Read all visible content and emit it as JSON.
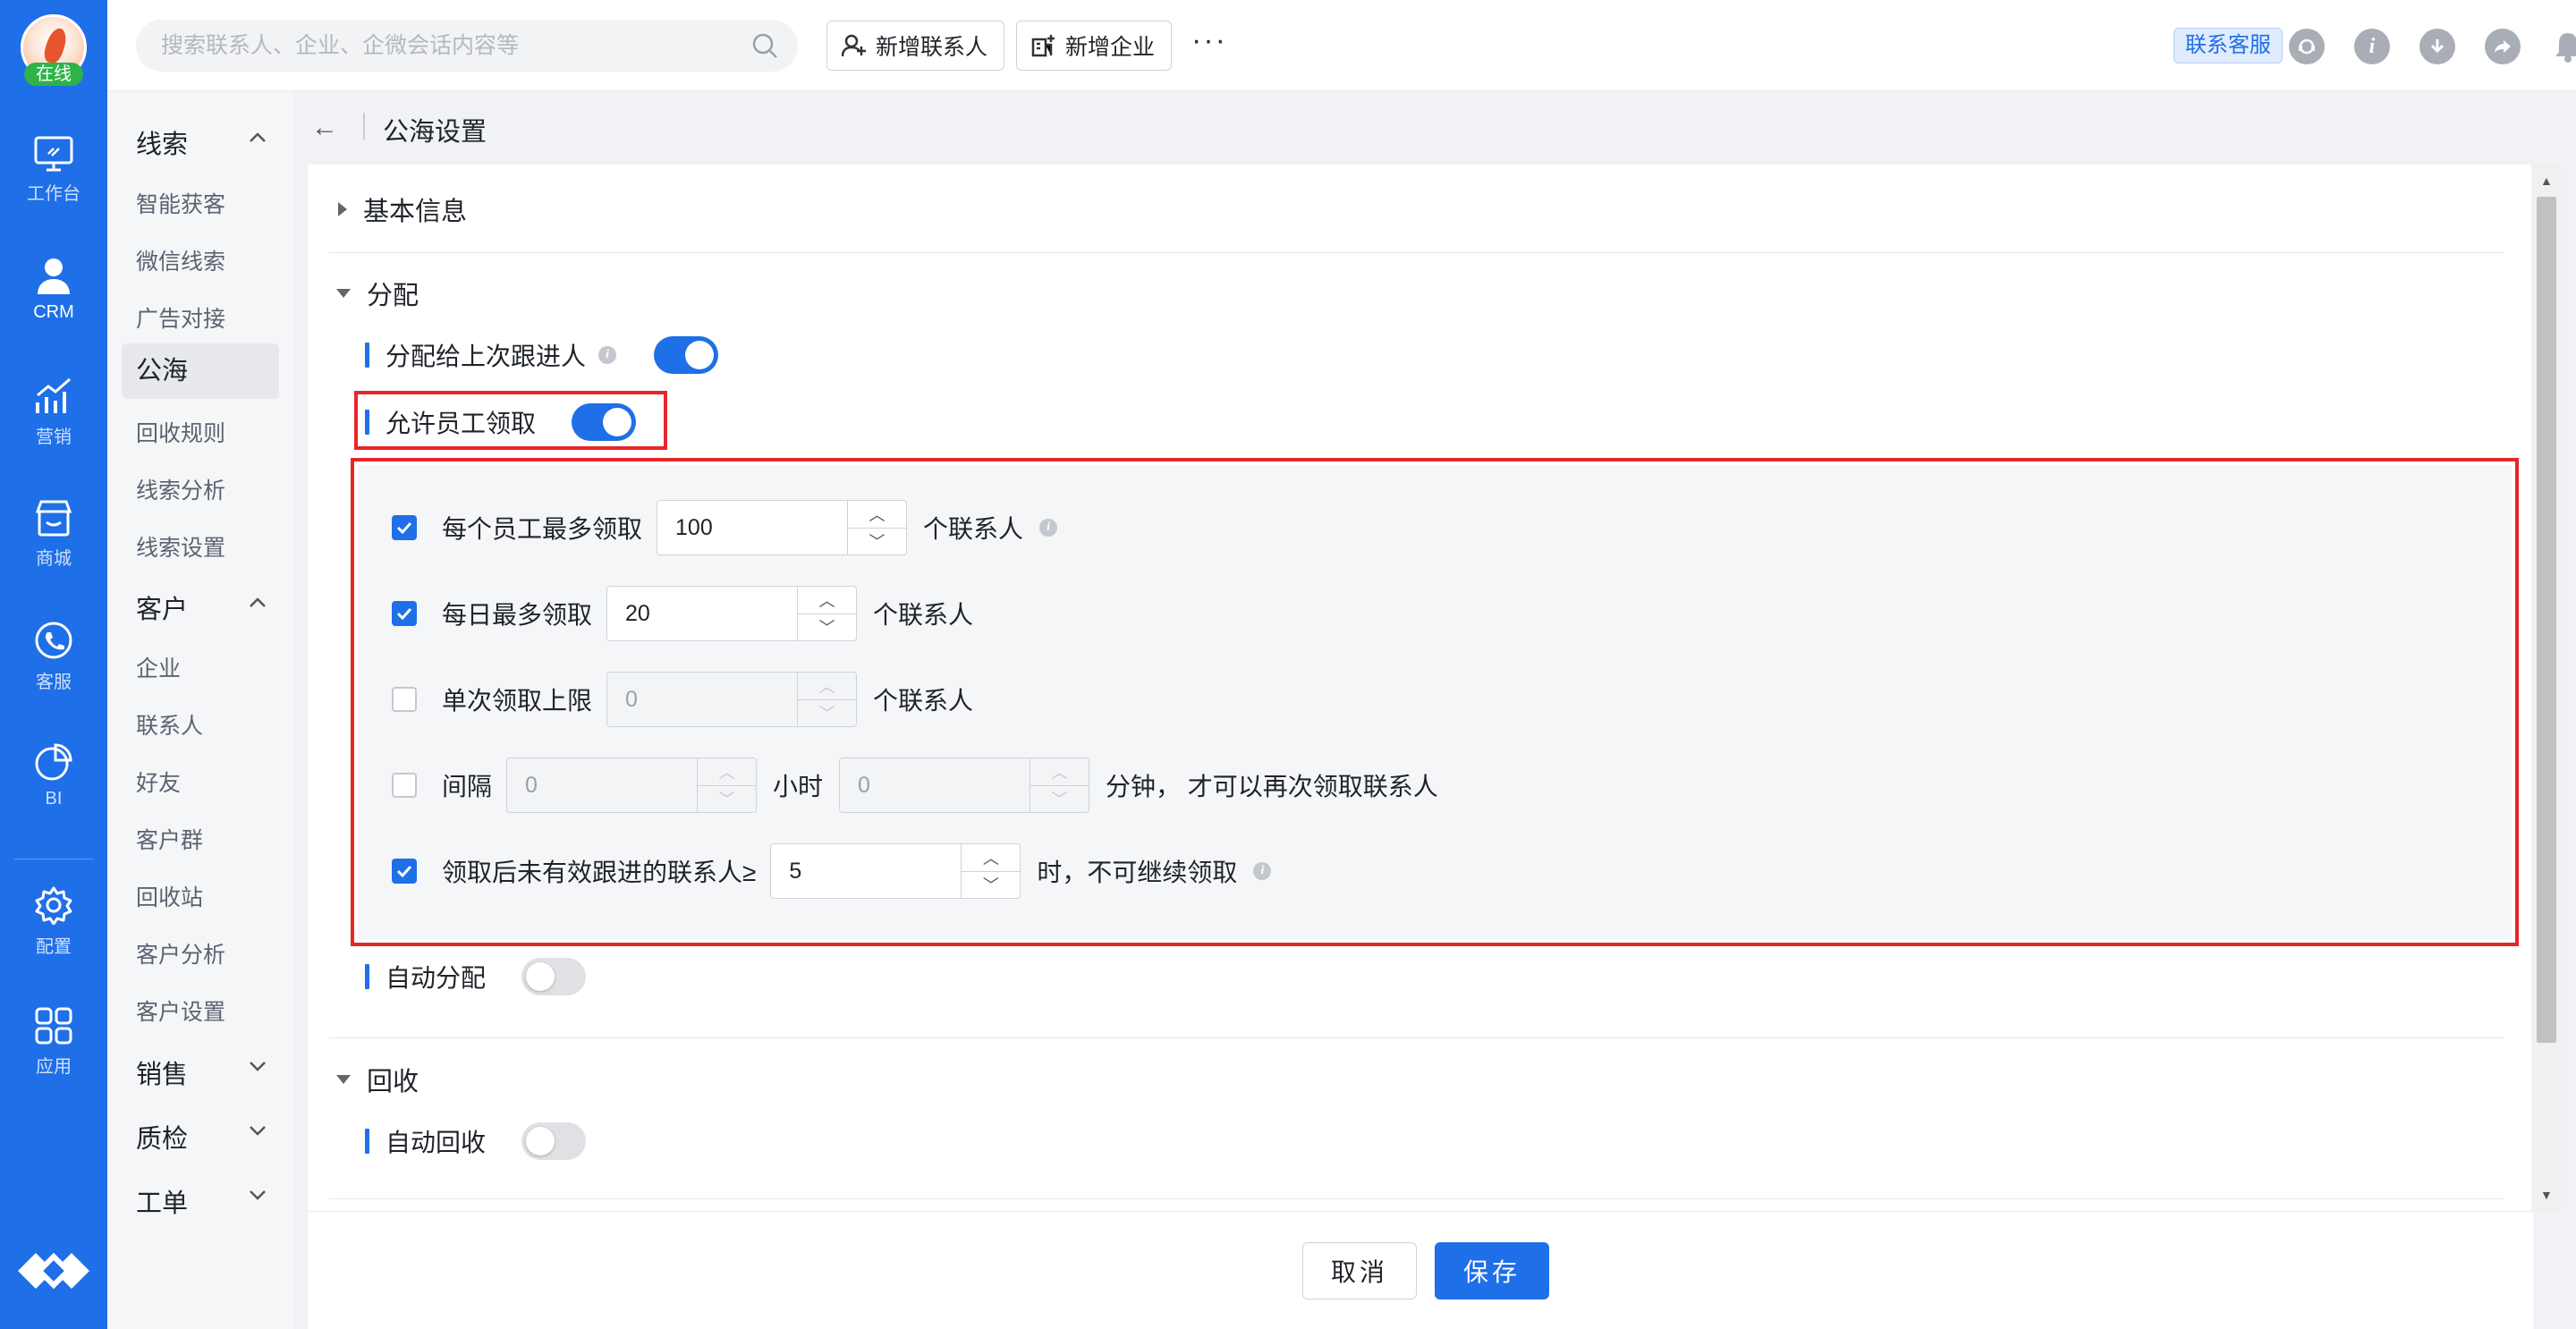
{
  "rail": {
    "status": "在线",
    "items": [
      {
        "label": "工作台",
        "icon": "workbench-icon"
      },
      {
        "label": "CRM",
        "icon": "person-icon"
      },
      {
        "label": "营销",
        "icon": "growth-chart-icon"
      },
      {
        "label": "商城",
        "icon": "store-icon"
      },
      {
        "label": "客服",
        "icon": "phone-icon"
      },
      {
        "label": "BI",
        "icon": "pie-chart-icon"
      },
      {
        "label": "配置",
        "icon": "gear-icon"
      },
      {
        "label": "应用",
        "icon": "apps-grid-icon"
      }
    ],
    "active": "CRM"
  },
  "topbar": {
    "search_placeholder": "搜索联系人、企业、企微会话内容等",
    "add_contact": "新增联系人",
    "add_company": "新增企业",
    "more": "···",
    "customer_service": "联系客服"
  },
  "menu": {
    "groups": [
      {
        "label": "线索",
        "expanded": true,
        "items": [
          "智能获客",
          "微信线索",
          "广告对接",
          "公海",
          "回收规则",
          "线索分析",
          "线索设置"
        ]
      },
      {
        "label": "客户",
        "expanded": true,
        "items": [
          "企业",
          "联系人",
          "好友",
          "客户群",
          "回收站",
          "客户分析",
          "客户设置"
        ]
      },
      {
        "label": "销售",
        "expanded": false
      },
      {
        "label": "质检",
        "expanded": false
      },
      {
        "label": "工单",
        "expanded": false
      }
    ],
    "active": "公海"
  },
  "page": {
    "back": "←",
    "title": "公海设置"
  },
  "sections": {
    "basic": "基本信息",
    "assign": "分配",
    "assign_last": "分配给上次跟进人",
    "allow_claim": "允许员工领取",
    "auto_assign": "自动分配",
    "recycle": "回收",
    "auto_recycle": "自动回收"
  },
  "rules": [
    {
      "checked": true,
      "label": "每个员工最多领取",
      "value": "100",
      "suffix": "个联系人",
      "info": true
    },
    {
      "checked": true,
      "label": "每日最多领取",
      "value": "20",
      "suffix": "个联系人"
    },
    {
      "checked": false,
      "label": "单次领取上限",
      "value": "0",
      "suffix": "个联系人"
    },
    {
      "checked": false,
      "label": "间隔",
      "value": "0",
      "mid": "小时",
      "value2": "0",
      "suffix": "分钟， 才可以再次领取联系人"
    },
    {
      "checked": true,
      "label": "领取后未有效跟进的联系人≥",
      "value": "5",
      "suffix": "时，不可继续领取",
      "info": true
    }
  ],
  "toggles": {
    "assign_last": true,
    "allow_claim": true,
    "auto_assign": false,
    "auto_recycle": false
  },
  "footer": {
    "cancel": "取消",
    "save": "保存"
  },
  "colors": {
    "brand": "#1e6fe8",
    "highlight_border": "#e8262a"
  }
}
